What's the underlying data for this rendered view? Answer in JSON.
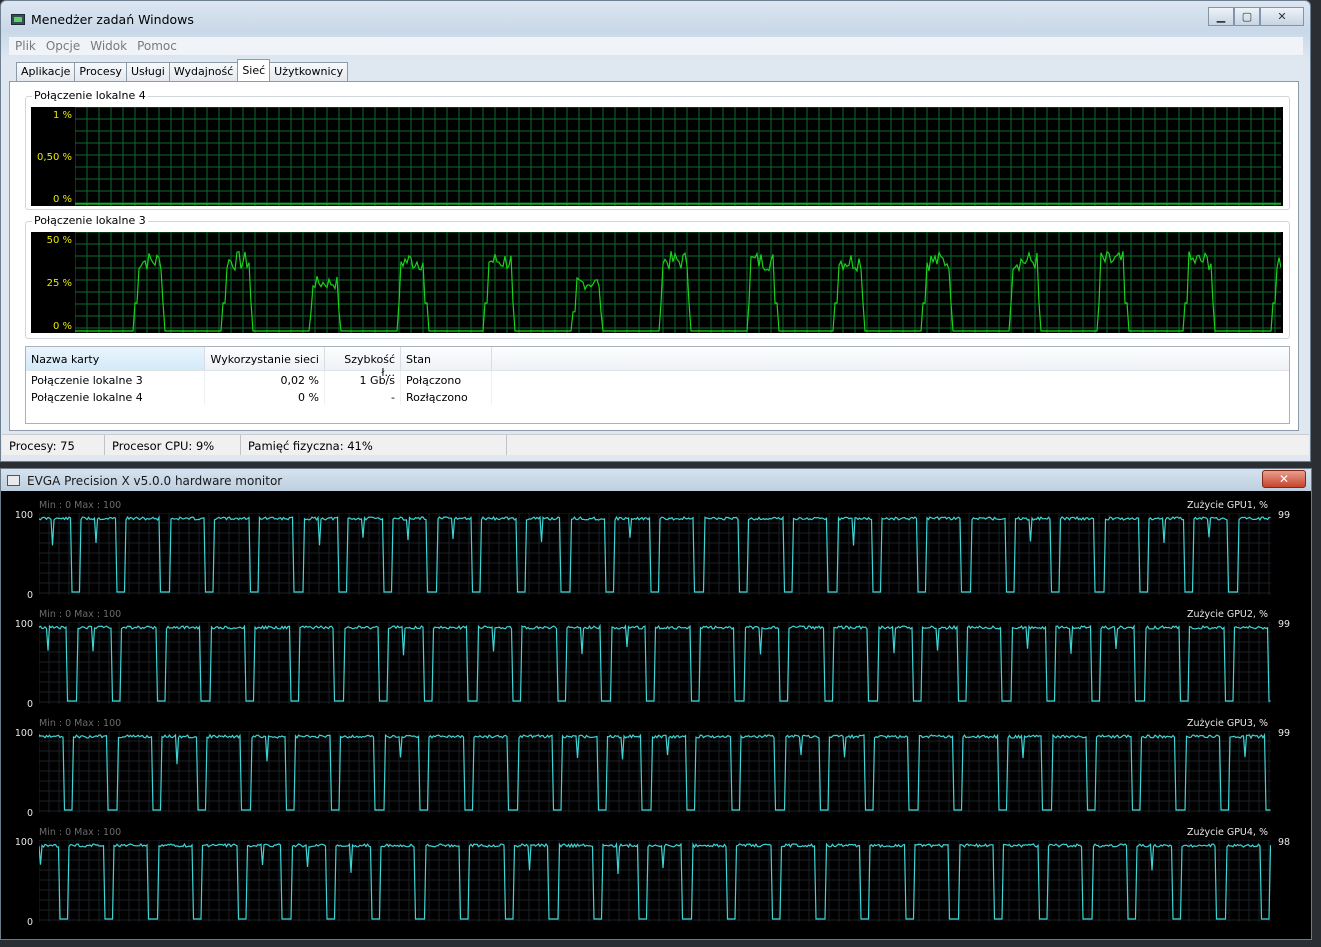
{
  "taskmanager": {
    "title": "Menedżer zadań Windows",
    "menu": [
      "Plik",
      "Opcje",
      "Widok",
      "Pomoc"
    ],
    "tabs": [
      "Aplikacje",
      "Procesy",
      "Usługi",
      "Wydajność",
      "Sieć",
      "Użytkownicy"
    ],
    "active_tab": "Sieć",
    "graph1": {
      "label": "Połączenie lokalne 4",
      "ticks": [
        "1 %",
        "0,50 %",
        "0 %"
      ],
      "line_color": "#19d219"
    },
    "graph2": {
      "label": "Połączenie lokalne 3",
      "ticks": [
        "50 %",
        "25 %",
        "0 %"
      ],
      "line_color": "#19d219"
    },
    "table": {
      "headers": [
        "Nazwa karty",
        "Wykorzystanie sieci",
        "Szybkość ł...",
        "Stan"
      ],
      "rows": [
        [
          "Połączenie lokalne 3",
          "0,02 %",
          "1 Gb/s",
          "Połączono"
        ],
        [
          "Połączenie lokalne 4",
          "0 %",
          "-",
          "Rozłączono"
        ]
      ]
    },
    "status": {
      "processes": "Procesy: 75",
      "cpu": "Procesor CPU: 9%",
      "memory": "Pamięć fizyczna: 41%"
    }
  },
  "evga": {
    "title": "EVGA Precision X v5.0.0 hardware monitor",
    "close": "✕",
    "line_color": "#3fd5d5",
    "panels": [
      {
        "minmax": "Min : 0 Max : 100",
        "title": "Zużycie GPU1, %",
        "ymax": "100",
        "ymin": "0",
        "current": "99"
      },
      {
        "minmax": "Min : 0 Max : 100",
        "title": "Zużycie GPU2, %",
        "ymax": "100",
        "ymin": "0",
        "current": "99"
      },
      {
        "minmax": "Min : 0 Max : 100",
        "title": "Zużycie GPU3, %",
        "ymax": "100",
        "ymin": "0",
        "current": "99"
      },
      {
        "minmax": "Min : 0 Max : 100",
        "title": "Zużycie GPU4, %",
        "ymax": "100",
        "ymin": "0",
        "current": "98"
      }
    ]
  }
}
